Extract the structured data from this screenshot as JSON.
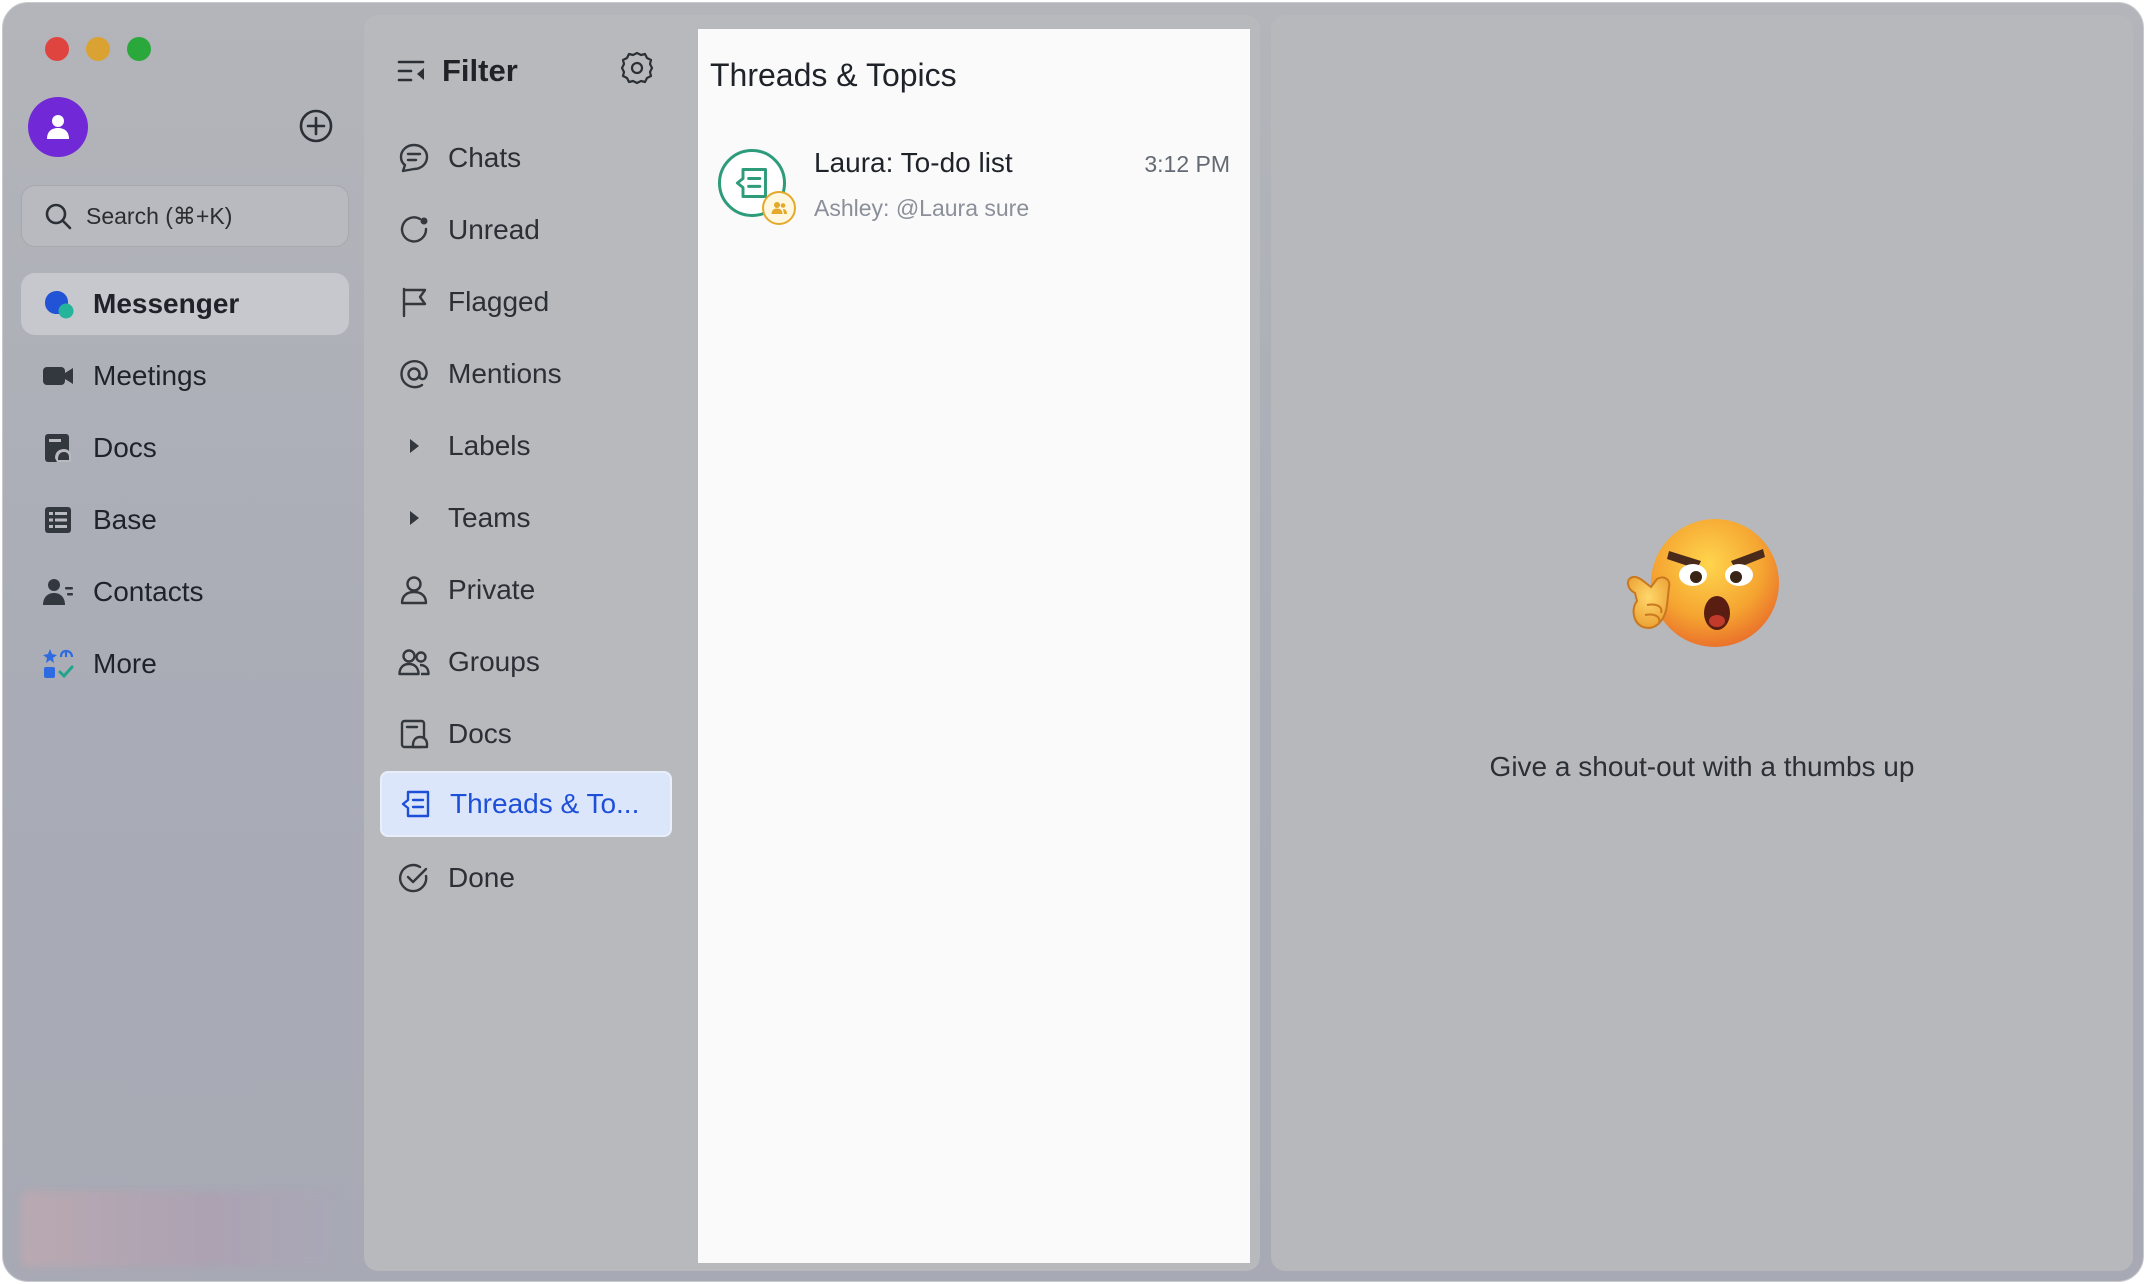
{
  "window": {
    "controls": [
      "close",
      "minimize",
      "maximize"
    ]
  },
  "nav": {
    "search_label": "Search (⌘+K)",
    "items": [
      {
        "label": "Messenger",
        "icon": "messenger-icon",
        "active": true
      },
      {
        "label": "Meetings",
        "icon": "video-camera-icon"
      },
      {
        "label": "Docs",
        "icon": "docs-icon"
      },
      {
        "label": "Base",
        "icon": "table-icon"
      },
      {
        "label": "Contacts",
        "icon": "contacts-icon"
      },
      {
        "label": "More",
        "icon": "apps-grid-icon"
      }
    ]
  },
  "filter": {
    "title": "Filter",
    "items": [
      {
        "label": "Chats",
        "icon": "chat-bubble-icon"
      },
      {
        "label": "Unread",
        "icon": "unread-icon"
      },
      {
        "label": "Flagged",
        "icon": "flag-icon"
      },
      {
        "label": "Mentions",
        "icon": "at-sign-icon"
      },
      {
        "label": "Labels",
        "icon": "caret-right-icon"
      },
      {
        "label": "Teams",
        "icon": "caret-right-icon"
      },
      {
        "label": "Private",
        "icon": "person-icon"
      },
      {
        "label": "Groups",
        "icon": "group-icon"
      },
      {
        "label": "Docs",
        "icon": "doc-icon"
      },
      {
        "label": "Threads & To...",
        "icon": "thread-icon",
        "active": true
      },
      {
        "label": "Done",
        "icon": "check-circle-icon"
      }
    ]
  },
  "list": {
    "title": "Threads & Topics",
    "threads": [
      {
        "name": "Laura: To-do list",
        "time": "3:12 PM",
        "preview": "Ashley: @Laura sure"
      }
    ]
  },
  "detail": {
    "empty_message": "Give a shout-out with a thumbs up"
  },
  "colors": {
    "accent": "#1d4fd8",
    "avatar": "#7129d8",
    "thread_ring": "#2e9b7a",
    "badge_ring": "#e4a92a"
  }
}
